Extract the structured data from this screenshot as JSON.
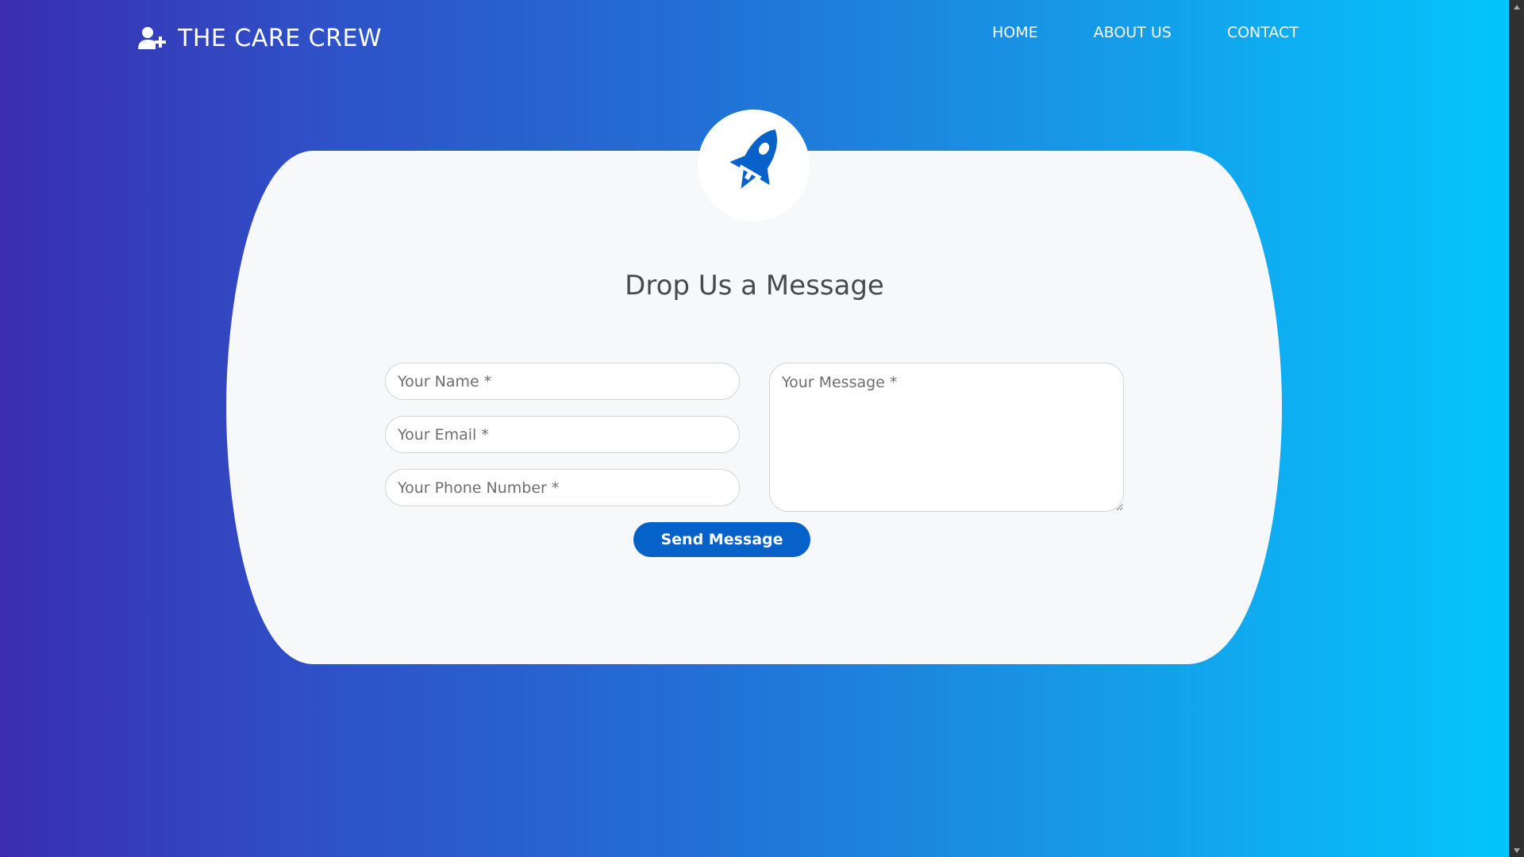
{
  "brand": {
    "icon": "user-plus-icon",
    "name": "THE CARE CREW"
  },
  "nav": {
    "items": [
      {
        "label": "HOME"
      },
      {
        "label": "ABOUT US"
      },
      {
        "label": "CONTACT"
      }
    ]
  },
  "contact": {
    "icon": "rocket-icon",
    "title": "Drop Us a Message",
    "name_placeholder": "Your Name *",
    "email_placeholder": "Your Email *",
    "phone_placeholder": "Your Phone Number *",
    "message_placeholder": "Your Message *",
    "submit_label": "Send Message"
  },
  "colors": {
    "gradient_start": "#3a2db0",
    "gradient_end": "#04c5fd",
    "accent": "#0662c9",
    "card": "#f7f8fa"
  }
}
